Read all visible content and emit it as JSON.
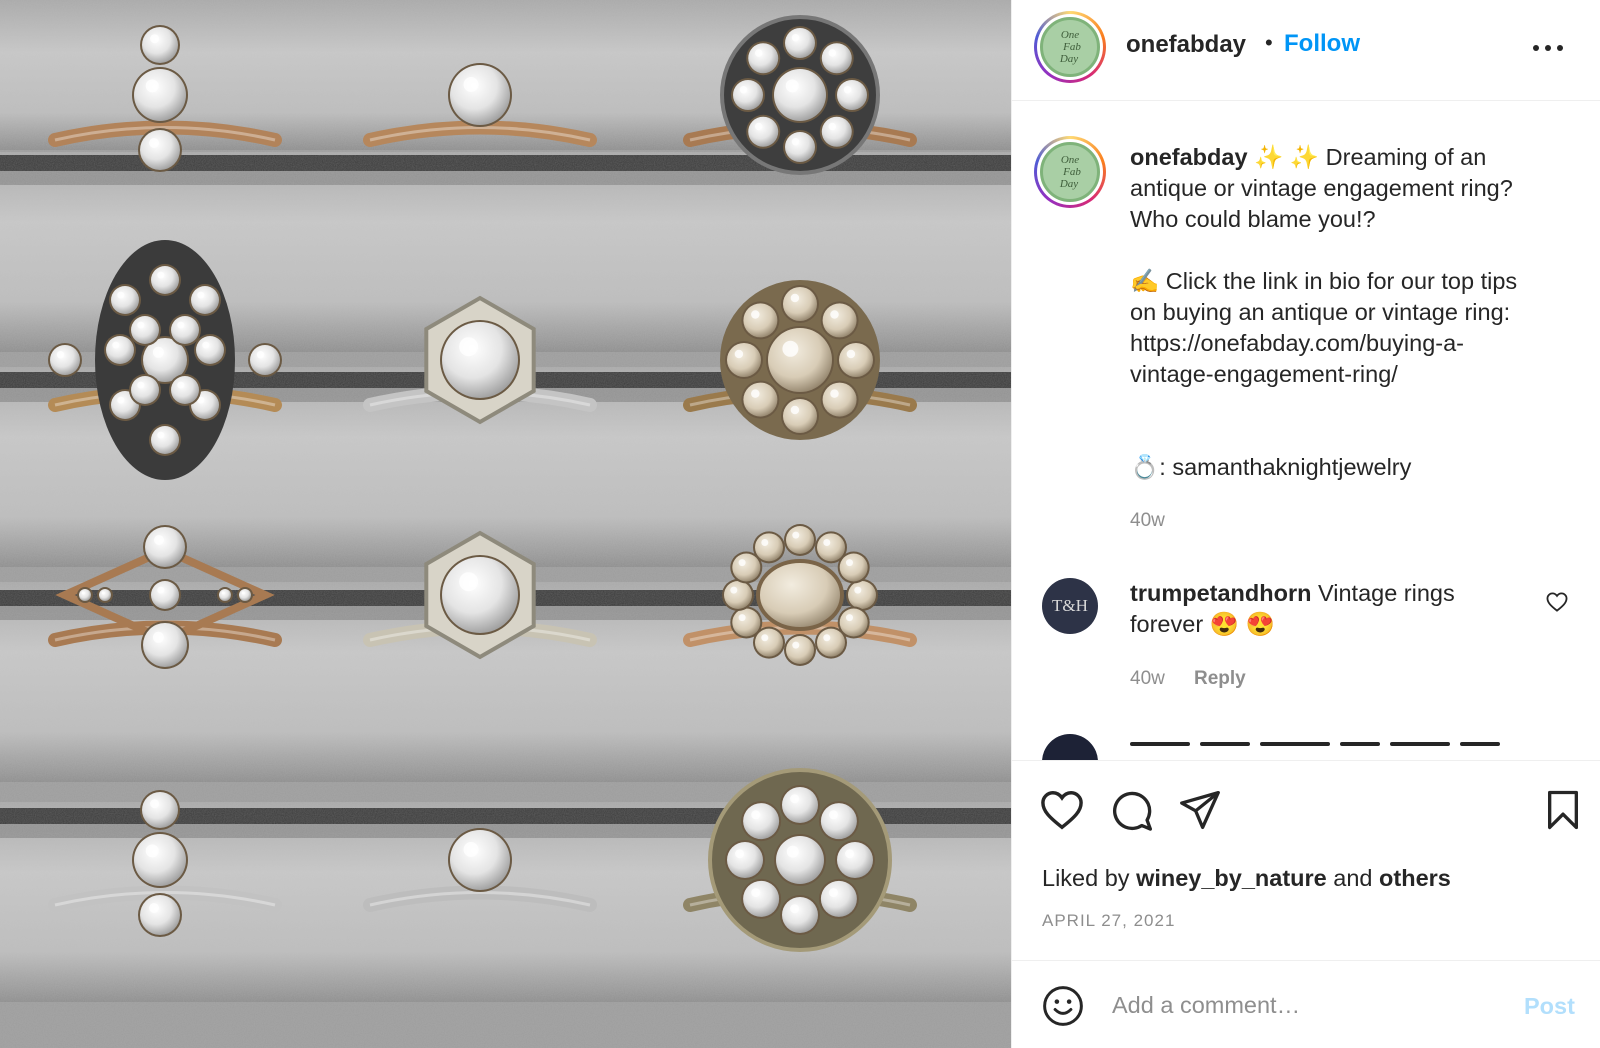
{
  "post": {
    "image_alt": "Antique and vintage engagement rings displayed on grey velvet",
    "rings": [
      {
        "row": 0,
        "col": 0,
        "metal": "#b2835a",
        "style": "trio"
      },
      {
        "row": 0,
        "col": 1,
        "metal": "#b6875c",
        "style": "solitaire"
      },
      {
        "row": 0,
        "col": 2,
        "metal": "#a87a52",
        "style": "cluster-dark"
      },
      {
        "row": 1,
        "col": 0,
        "metal": "#b48b56",
        "style": "navette"
      },
      {
        "row": 1,
        "col": 1,
        "metal": "#c4c4c4",
        "style": "hexagon"
      },
      {
        "row": 1,
        "col": 2,
        "metal": "#9a7a4c",
        "style": "rose-cluster"
      },
      {
        "row": 2,
        "col": 0,
        "metal": "#a87a52",
        "style": "openwork"
      },
      {
        "row": 2,
        "col": 1,
        "metal": "#c8c3b3",
        "style": "hexagon"
      },
      {
        "row": 2,
        "col": 2,
        "metal": "#c19168",
        "style": "halo-oval"
      },
      {
        "row": 3,
        "col": 0,
        "metal": "#c2c2c2",
        "style": "trio"
      },
      {
        "row": 3,
        "col": 1,
        "metal": "#bdbdbd",
        "style": "solitaire"
      },
      {
        "row": 3,
        "col": 2,
        "metal": "#8f8566",
        "style": "star-cluster"
      }
    ]
  },
  "header": {
    "username": "onefabday",
    "separator": "•",
    "follow_label": "Follow",
    "more_icon": "more-horizontal-icon"
  },
  "avatar": {
    "logo_lines": [
      "One",
      "Fab",
      "Day"
    ]
  },
  "caption": {
    "username": "onefabday",
    "sparkles": "✨ ✨",
    "line1": " Dreaming of an",
    "line2": "antique or vintage engagement ring?",
    "line3": "Who could blame you!?",
    "line4_emoji": "✍️",
    "line4": " Click the link in bio for our top tips",
    "line5": "on buying an antique or vintage ring:",
    "line6": "https://onefabday.com/buying-a-",
    "line7": "vintage-engagement-ring/",
    "line8_emoji": "💍",
    "line8": ": samanthaknightjewelry",
    "time": "40w"
  },
  "comment": {
    "avatar_text": "T&H",
    "username": "trumpetandhorn",
    "text": " Vintage rings",
    "text2": "forever ",
    "emojis": "😍 😍",
    "time": "40w",
    "reply_label": "Reply"
  },
  "actions": {
    "liked_prefix": "Liked by ",
    "liked_user": "winey_by_nature",
    "liked_mid": " and ",
    "liked_others": "others",
    "date": "APRIL 27, 2021"
  },
  "add_comment": {
    "placeholder": "Add a comment…",
    "post_label": "Post"
  },
  "colors": {
    "follow": "#0095f6",
    "post_disabled": "#b2dffc",
    "muted": "#8e8e8e",
    "text": "#262626"
  }
}
